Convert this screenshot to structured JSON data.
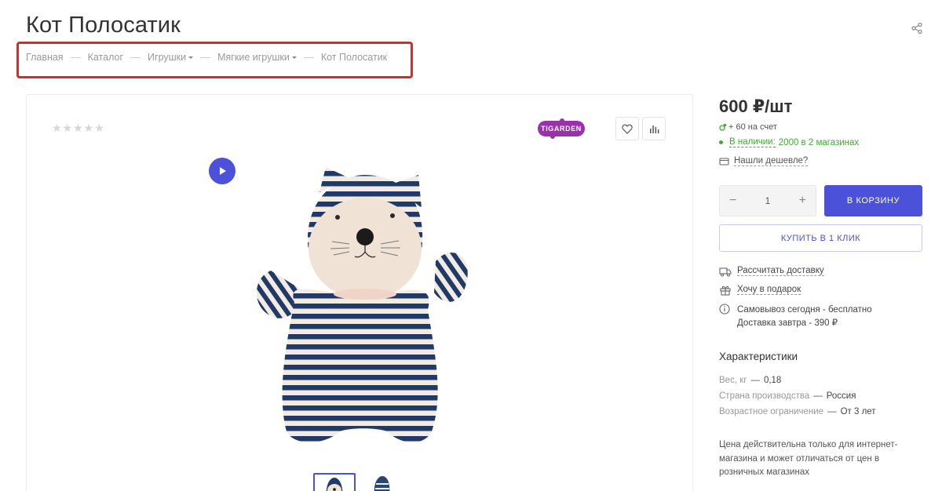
{
  "page": {
    "title": "Кот Полосатик"
  },
  "breadcrumb": [
    {
      "label": "Главная"
    },
    {
      "label": "Каталог"
    },
    {
      "label": "Игрушки"
    },
    {
      "label": "Мягкие игрушки"
    },
    {
      "label": "Кот Полосатик"
    }
  ],
  "gallery": {
    "rating_stars": "★★★★★",
    "brand": "TIGARDEN"
  },
  "buy_box": {
    "price": "600 ₽/шт",
    "bonus": "+ 60 на счет",
    "stock_label": "В наличии:",
    "stock_detail": "2000 в 2 магазинах",
    "cheaper": "Нашли дешевле?",
    "quantity": "1",
    "minus": "−",
    "plus": "+",
    "cart_button": "В КОРЗИНУ",
    "one_click_button": "КУПИТЬ В 1 КЛИК"
  },
  "services": {
    "delivery": "Рассчитать доставку",
    "gift": "Хочу в подарок",
    "pickup": "Самовывоз сегодня - бесплатно",
    "delivery_tomorrow": "Доставка завтра - 390 ₽"
  },
  "specs": {
    "title": "Характеристики",
    "items": [
      {
        "name": "Вес, кг",
        "value": "0,18"
      },
      {
        "name": "Страна производства",
        "value": "Россия"
      },
      {
        "name": "Возрастное ограничение",
        "value": "От 3 лет"
      }
    ]
  },
  "note": "Цена действительна только для интернет-магазина и может отличаться от цен в розничных магазинах",
  "colors": {
    "accent": "#4c51d9",
    "stock_green": "#3cae2c",
    "brand_purple": "#9b2fae",
    "highlight_red": "#e02828"
  }
}
